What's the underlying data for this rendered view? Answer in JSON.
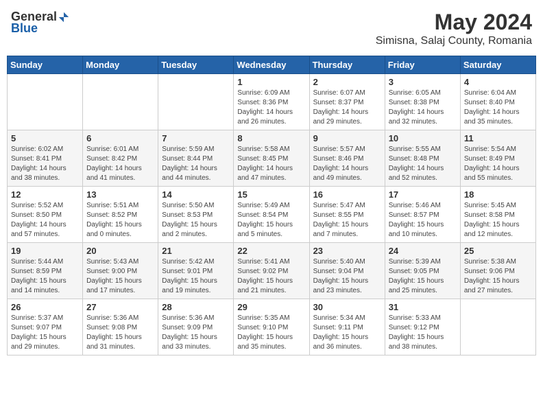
{
  "header": {
    "logo_general": "General",
    "logo_blue": "Blue",
    "main_title": "May 2024",
    "subtitle": "Simisna, Salaj County, Romania"
  },
  "days_of_week": [
    "Sunday",
    "Monday",
    "Tuesday",
    "Wednesday",
    "Thursday",
    "Friday",
    "Saturday"
  ],
  "weeks": [
    [
      {
        "day": "",
        "info": ""
      },
      {
        "day": "",
        "info": ""
      },
      {
        "day": "",
        "info": ""
      },
      {
        "day": "1",
        "info": "Sunrise: 6:09 AM\nSunset: 8:36 PM\nDaylight: 14 hours\nand 26 minutes."
      },
      {
        "day": "2",
        "info": "Sunrise: 6:07 AM\nSunset: 8:37 PM\nDaylight: 14 hours\nand 29 minutes."
      },
      {
        "day": "3",
        "info": "Sunrise: 6:05 AM\nSunset: 8:38 PM\nDaylight: 14 hours\nand 32 minutes."
      },
      {
        "day": "4",
        "info": "Sunrise: 6:04 AM\nSunset: 8:40 PM\nDaylight: 14 hours\nand 35 minutes."
      }
    ],
    [
      {
        "day": "5",
        "info": "Sunrise: 6:02 AM\nSunset: 8:41 PM\nDaylight: 14 hours\nand 38 minutes."
      },
      {
        "day": "6",
        "info": "Sunrise: 6:01 AM\nSunset: 8:42 PM\nDaylight: 14 hours\nand 41 minutes."
      },
      {
        "day": "7",
        "info": "Sunrise: 5:59 AM\nSunset: 8:44 PM\nDaylight: 14 hours\nand 44 minutes."
      },
      {
        "day": "8",
        "info": "Sunrise: 5:58 AM\nSunset: 8:45 PM\nDaylight: 14 hours\nand 47 minutes."
      },
      {
        "day": "9",
        "info": "Sunrise: 5:57 AM\nSunset: 8:46 PM\nDaylight: 14 hours\nand 49 minutes."
      },
      {
        "day": "10",
        "info": "Sunrise: 5:55 AM\nSunset: 8:48 PM\nDaylight: 14 hours\nand 52 minutes."
      },
      {
        "day": "11",
        "info": "Sunrise: 5:54 AM\nSunset: 8:49 PM\nDaylight: 14 hours\nand 55 minutes."
      }
    ],
    [
      {
        "day": "12",
        "info": "Sunrise: 5:52 AM\nSunset: 8:50 PM\nDaylight: 14 hours\nand 57 minutes."
      },
      {
        "day": "13",
        "info": "Sunrise: 5:51 AM\nSunset: 8:52 PM\nDaylight: 15 hours\nand 0 minutes."
      },
      {
        "day": "14",
        "info": "Sunrise: 5:50 AM\nSunset: 8:53 PM\nDaylight: 15 hours\nand 2 minutes."
      },
      {
        "day": "15",
        "info": "Sunrise: 5:49 AM\nSunset: 8:54 PM\nDaylight: 15 hours\nand 5 minutes."
      },
      {
        "day": "16",
        "info": "Sunrise: 5:47 AM\nSunset: 8:55 PM\nDaylight: 15 hours\nand 7 minutes."
      },
      {
        "day": "17",
        "info": "Sunrise: 5:46 AM\nSunset: 8:57 PM\nDaylight: 15 hours\nand 10 minutes."
      },
      {
        "day": "18",
        "info": "Sunrise: 5:45 AM\nSunset: 8:58 PM\nDaylight: 15 hours\nand 12 minutes."
      }
    ],
    [
      {
        "day": "19",
        "info": "Sunrise: 5:44 AM\nSunset: 8:59 PM\nDaylight: 15 hours\nand 14 minutes."
      },
      {
        "day": "20",
        "info": "Sunrise: 5:43 AM\nSunset: 9:00 PM\nDaylight: 15 hours\nand 17 minutes."
      },
      {
        "day": "21",
        "info": "Sunrise: 5:42 AM\nSunset: 9:01 PM\nDaylight: 15 hours\nand 19 minutes."
      },
      {
        "day": "22",
        "info": "Sunrise: 5:41 AM\nSunset: 9:02 PM\nDaylight: 15 hours\nand 21 minutes."
      },
      {
        "day": "23",
        "info": "Sunrise: 5:40 AM\nSunset: 9:04 PM\nDaylight: 15 hours\nand 23 minutes."
      },
      {
        "day": "24",
        "info": "Sunrise: 5:39 AM\nSunset: 9:05 PM\nDaylight: 15 hours\nand 25 minutes."
      },
      {
        "day": "25",
        "info": "Sunrise: 5:38 AM\nSunset: 9:06 PM\nDaylight: 15 hours\nand 27 minutes."
      }
    ],
    [
      {
        "day": "26",
        "info": "Sunrise: 5:37 AM\nSunset: 9:07 PM\nDaylight: 15 hours\nand 29 minutes."
      },
      {
        "day": "27",
        "info": "Sunrise: 5:36 AM\nSunset: 9:08 PM\nDaylight: 15 hours\nand 31 minutes."
      },
      {
        "day": "28",
        "info": "Sunrise: 5:36 AM\nSunset: 9:09 PM\nDaylight: 15 hours\nand 33 minutes."
      },
      {
        "day": "29",
        "info": "Sunrise: 5:35 AM\nSunset: 9:10 PM\nDaylight: 15 hours\nand 35 minutes."
      },
      {
        "day": "30",
        "info": "Sunrise: 5:34 AM\nSunset: 9:11 PM\nDaylight: 15 hours\nand 36 minutes."
      },
      {
        "day": "31",
        "info": "Sunrise: 5:33 AM\nSunset: 9:12 PM\nDaylight: 15 hours\nand 38 minutes."
      },
      {
        "day": "",
        "info": ""
      }
    ]
  ]
}
